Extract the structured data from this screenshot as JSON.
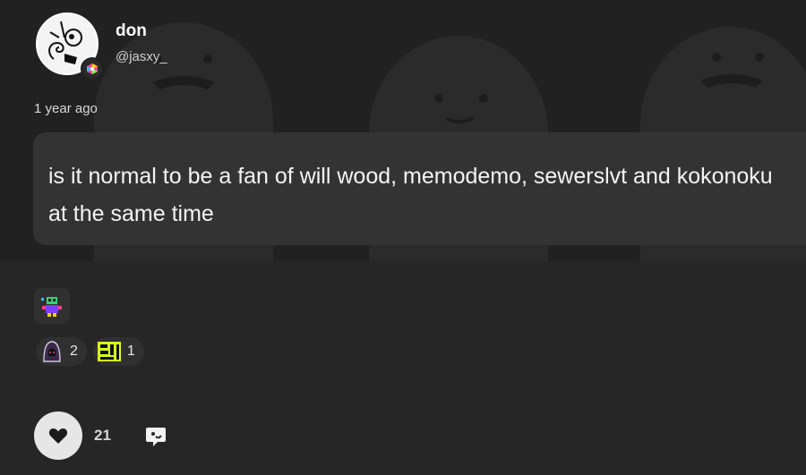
{
  "post": {
    "author": {
      "display_name": "don",
      "handle": "@jasxy_",
      "avatar_icon": "spiral-face-avatar",
      "badge_icon": "colorful-hexagon-badge-icon"
    },
    "timestamp": "1 year ago",
    "message": "is it normal to be a fan of will wood, memodemo, sewerslvt and kokonoku at the same time",
    "user_badge_icon": "pixel-character-badge-icon",
    "reactions": [
      {
        "icon": "hooded-figure-emoji-icon",
        "count": "2"
      },
      {
        "icon": "pixel-maze-emoji-icon",
        "count": "1"
      }
    ],
    "likes": "21"
  },
  "colors": {
    "background": "#262626",
    "banner": "#212121",
    "bubble": "#333333",
    "like_button": "#e6e6e6"
  }
}
